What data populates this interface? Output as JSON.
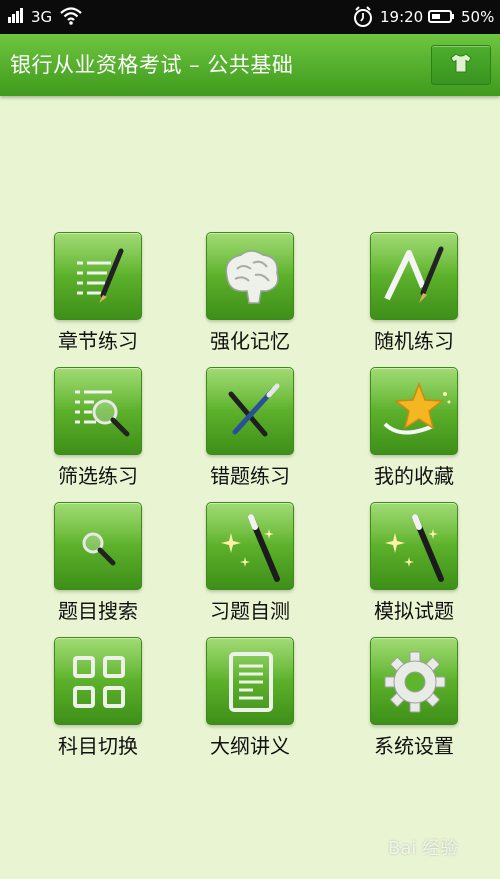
{
  "status_bar": {
    "network": "3G",
    "time": "19:20",
    "battery_percent_text": "50%",
    "battery_level": 0.5,
    "icons": [
      "signal-icon",
      "wifi-icon",
      "alarm-icon",
      "battery-icon"
    ]
  },
  "header": {
    "title": "银行从业资格考试 – 公共基础",
    "theme_button_icon": "shirt-icon"
  },
  "menu": [
    {
      "label": "章节练习",
      "icon": "list-pen-icon"
    },
    {
      "label": "强化记忆",
      "icon": "brain-icon"
    },
    {
      "label": "随机练习",
      "icon": "triangle-pen-icon"
    },
    {
      "label": "筛选练习",
      "icon": "list-magnifier-icon"
    },
    {
      "label": "错题练习",
      "icon": "cross-pens-icon"
    },
    {
      "label": "我的收藏",
      "icon": "star-icon"
    },
    {
      "label": "题目搜索",
      "icon": "magnifier-icon"
    },
    {
      "label": "习题自测",
      "icon": "magic-wand-icon"
    },
    {
      "label": "模拟试题",
      "icon": "magic-wand-icon"
    },
    {
      "label": "科目切换",
      "icon": "grid-icon"
    },
    {
      "label": "大纲讲义",
      "icon": "document-icon"
    },
    {
      "label": "系统设置",
      "icon": "gear-icon"
    }
  ],
  "watermark": "Bai 经验",
  "colors": {
    "background": "#e9f5d2",
    "header_green": "#4fab27",
    "tile_green": "#5fb42d"
  }
}
